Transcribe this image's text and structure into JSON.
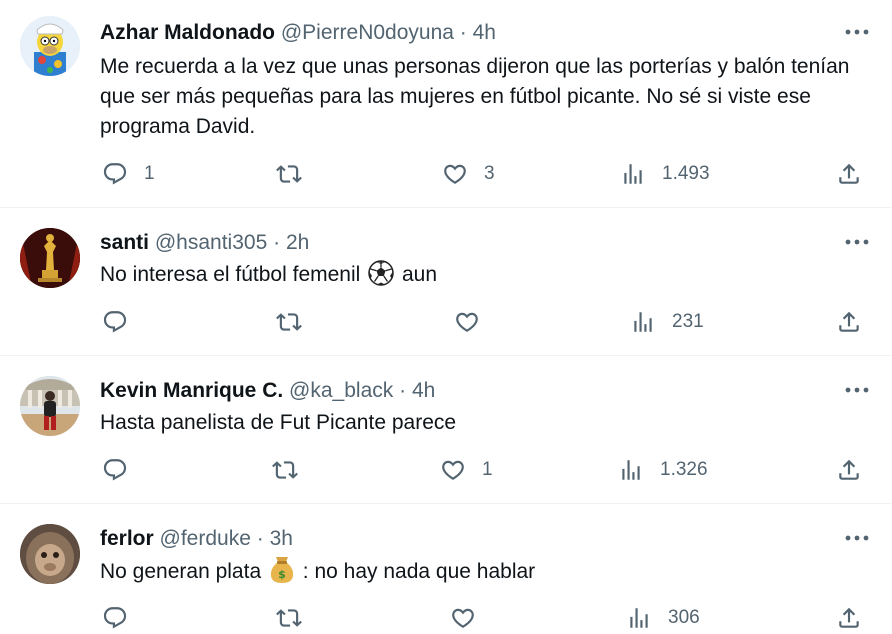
{
  "replies": [
    {
      "name": "Azhar Maldonado",
      "handle": "@PierreN0doyuna",
      "sep": "·",
      "time": "4h",
      "text": "Me recuerda a la vez que unas personas dijeron que las porterías y balón tenían que ser más pequeñas para las mujeres en fútbol picante. No sé si viste ese programa David.",
      "reply_count": "1",
      "retweet_count": "",
      "like_count": "3",
      "view_count": "1.493"
    },
    {
      "name": "santi",
      "handle": "@hsanti305",
      "sep": "·",
      "time": "2h",
      "text_before": "No interesa el fútbol femenil ",
      "emoji": "soccer-ball",
      "text_after": " aun",
      "reply_count": "",
      "retweet_count": "",
      "like_count": "",
      "view_count": "231"
    },
    {
      "name": "Kevin Manrique C.",
      "handle": "@ka_black",
      "sep": "·",
      "time": "4h",
      "text": "Hasta panelista de Fut Picante parece",
      "reply_count": "",
      "retweet_count": "",
      "like_count": "1",
      "view_count": "1.326"
    },
    {
      "name": "ferlor",
      "handle": "@ferduke",
      "sep": "·",
      "time": "3h",
      "text_before": "No generan plata ",
      "emoji": "money-bag",
      "text_after": " : no hay nada que hablar",
      "reply_count": "",
      "retweet_count": "",
      "like_count": "",
      "view_count": "306"
    }
  ],
  "icons": {
    "reply": "reply-icon",
    "retweet": "retweet-icon",
    "like": "heart-icon",
    "views": "views-icon",
    "share": "share-icon",
    "more": "more-icon"
  },
  "colors": {
    "text": "#0f1419",
    "secondary": "#536471",
    "divider": "#eff3f4"
  }
}
